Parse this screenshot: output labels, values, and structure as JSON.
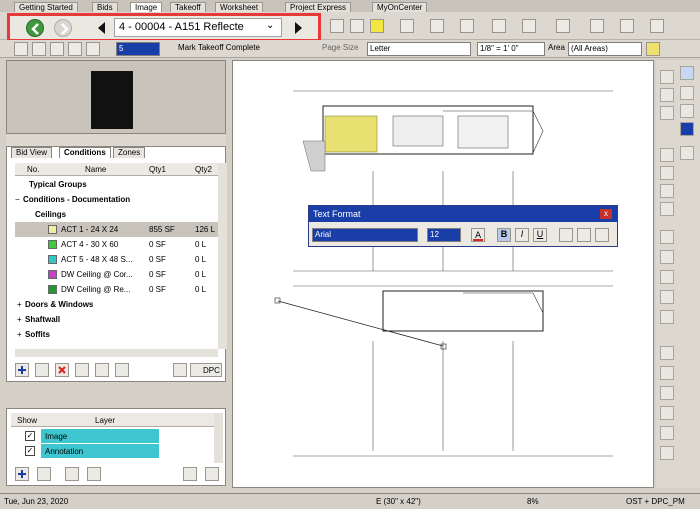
{
  "top_tabs": [
    "Getting Started",
    "Bids",
    "Image",
    "Takeoff",
    "Worksheet",
    "Project Express",
    "MyOnCenter"
  ],
  "nav": {
    "page_title": "4 - 00004 - A151 Reflecte",
    "back_label": "back",
    "forward_label": "forward"
  },
  "toolbar2": {
    "mark_takeoff": "Mark Takeoff Complete",
    "page_size_label": "Page Size",
    "page_size_value": "Letter",
    "scale_value": "1/8\" = 1' 0\"",
    "area_label": "Area",
    "area_value": "(All Areas)",
    "zoom_value": "5"
  },
  "condpanel": {
    "tabs": [
      "Bid View",
      "Conditions",
      "Zones"
    ],
    "headers": [
      "No.",
      "Name",
      "Qty1",
      "Qty2"
    ],
    "rows": [
      {
        "name": "Typical Groups",
        "qty1": "",
        "qty2": "",
        "bold": true
      },
      {
        "name": "Conditions - Documentation",
        "qty1": "",
        "qty2": "",
        "bold": true
      },
      {
        "name": "Ceilings",
        "qty1": "",
        "qty2": "",
        "bold": true
      },
      {
        "name": "ACT 1 - 24 X 24",
        "qty1": "855 SF",
        "qty2": "126 L",
        "color": "#f0eca0",
        "selected": true
      },
      {
        "name": "ACT 4 - 30 X 60",
        "qty1": "0 SF",
        "qty2": "0 L",
        "color": "#3fc93f"
      },
      {
        "name": "ACT 5 - 48 X 48 S...",
        "qty1": "0 SF",
        "qty2": "0 L",
        "color": "#2fc7c7"
      },
      {
        "name": "DW Ceiling @ Cor...",
        "qty1": "0 SF",
        "qty2": "0 L",
        "color": "#c83fc8"
      },
      {
        "name": "DW Ceiling @ Re...",
        "qty1": "0 SF",
        "qty2": "0 L",
        "color": "#1f9a2f"
      },
      {
        "name": "Doors & Windows",
        "qty1": "",
        "qty2": "",
        "bold": true
      },
      {
        "name": "Shaftwall",
        "qty1": "",
        "qty2": "",
        "bold": true
      },
      {
        "name": "Soffits",
        "qty1": "",
        "qty2": "",
        "bold": true
      }
    ],
    "dpc_label": "DPC"
  },
  "layerpanel": {
    "headers": [
      "Show",
      "Layer"
    ],
    "rows": [
      "Image",
      "Annotation"
    ]
  },
  "text_format": {
    "title": "Text Format",
    "font": "Arial",
    "size": "12",
    "bold_label": "B",
    "italic_label": "I",
    "underline_label": "U"
  },
  "status": {
    "date": "Tue, Jun 23, 2020",
    "paper": "E (30\" x 42\")",
    "zoom": "8%",
    "user": "OST + DPC_PM"
  },
  "colors": {
    "highlight": "#e8393a",
    "title_blue": "#1a3ea8",
    "layer_cyan": "#3ec7d0"
  }
}
